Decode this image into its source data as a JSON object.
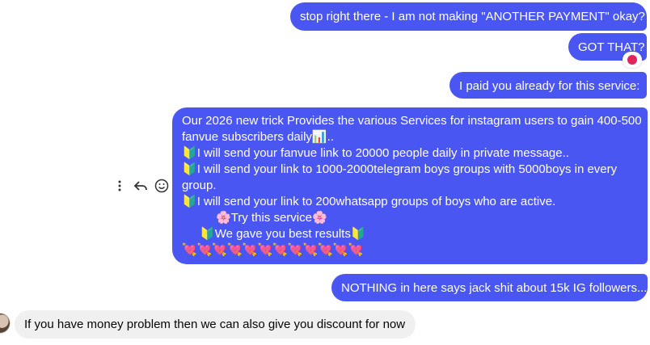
{
  "messages": {
    "m1": "stop right there - I am not making \"ANOTHER PAYMENT\" okay?",
    "m2": "GOT THAT?",
    "m3": "I paid you already for this service:",
    "m4": {
      "lines": [
        "Our 2026 new trick Provides the various Services for instagram users to gain 400-500",
        "fanvue subscribers daily",
        "I will send your fanvue link to 20000 people daily in private message..",
        "I will send your link to 1000-2000telegram boys groups with 5000boys in every",
        "group.",
        "I will send your link to 200whatsapp groups of boys who are active.",
        "Try this service",
        "We gave you best results",
        ""
      ],
      "line1_suffix": "..",
      "bullet_glyph": "🔰",
      "flower_glyph": "🌸",
      "heart_glyph": "💘",
      "heart_count": 12
    },
    "m5": "NOTHING in here says jack shit about 15k IG followers...",
    "m6": "If you have money problem then we can also give you discount for now"
  },
  "icons": {
    "more": "more-options-icon",
    "reply": "reply-icon",
    "react": "smiley-icon"
  },
  "colors": {
    "outgoing_bubble": "#4a56f2",
    "incoming_bubble": "#f0f0f0",
    "reaction": "#e0245e"
  }
}
